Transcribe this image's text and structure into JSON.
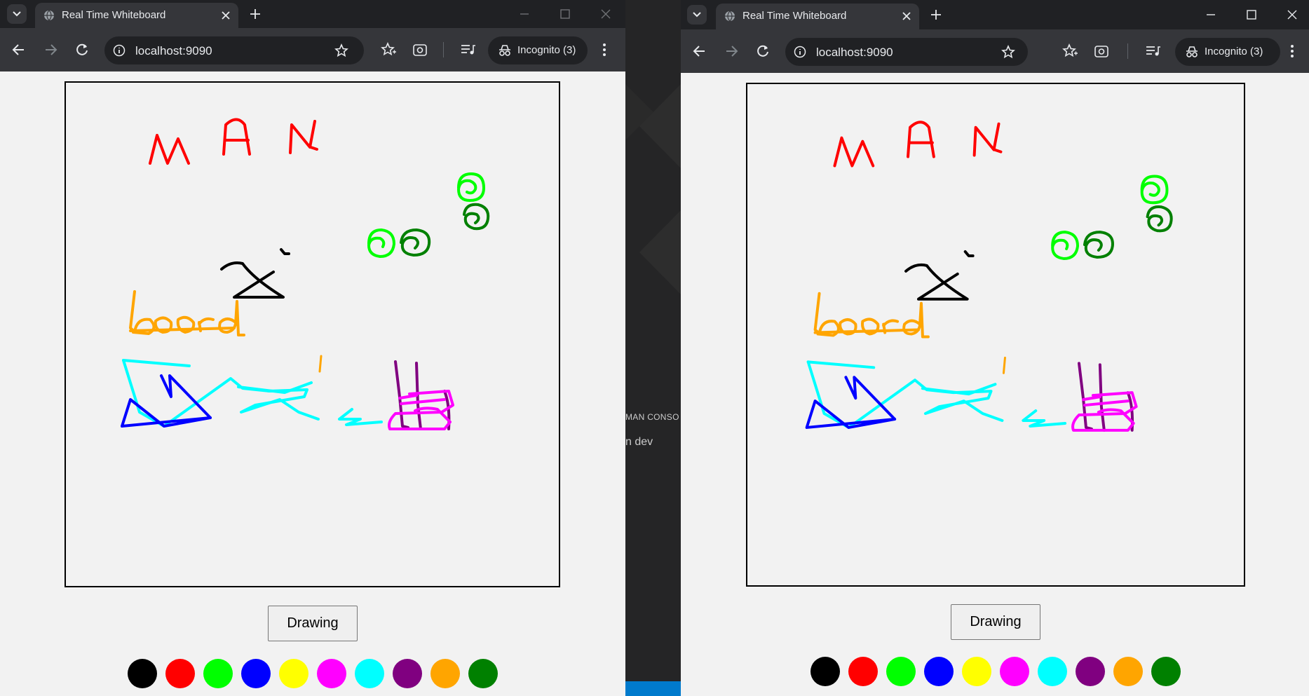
{
  "windows": [
    {
      "tab_title": "Real Time Whiteboard",
      "url": "localhost:9090",
      "incognito_label": "Incognito (3)",
      "mode_button_label": "Drawing"
    },
    {
      "tab_title": "Real Time Whiteboard",
      "url": "localhost:9090",
      "incognito_label": "Incognito (3)",
      "mode_button_label": "Drawing"
    }
  ],
  "palette": [
    {
      "name": "black",
      "hex": "#000000"
    },
    {
      "name": "red",
      "hex": "#ff0000"
    },
    {
      "name": "lime",
      "hex": "#00ff00"
    },
    {
      "name": "blue",
      "hex": "#0000ff"
    },
    {
      "name": "yellow",
      "hex": "#ffff00"
    },
    {
      "name": "magenta",
      "hex": "#ff00ff"
    },
    {
      "name": "cyan",
      "hex": "#00ffff"
    },
    {
      "name": "purple",
      "hex": "#800080"
    },
    {
      "name": "orange",
      "hex": "#ffa500"
    },
    {
      "name": "green",
      "hex": "#008000"
    }
  ],
  "background_editor": {
    "panel_header_fragment": "MAN CONSO",
    "terminal_fragment": "n  dev"
  },
  "icons": [
    "tab-search-icon",
    "globe-icon",
    "close-icon",
    "new-tab-icon",
    "minimize-icon",
    "maximize-icon",
    "window-close-icon",
    "back-icon",
    "forward-icon",
    "reload-icon",
    "site-info-icon",
    "bookmark-star-icon",
    "bookmarks-icon",
    "lens-icon",
    "reading-list-icon",
    "incognito-icon",
    "menu-icon"
  ]
}
